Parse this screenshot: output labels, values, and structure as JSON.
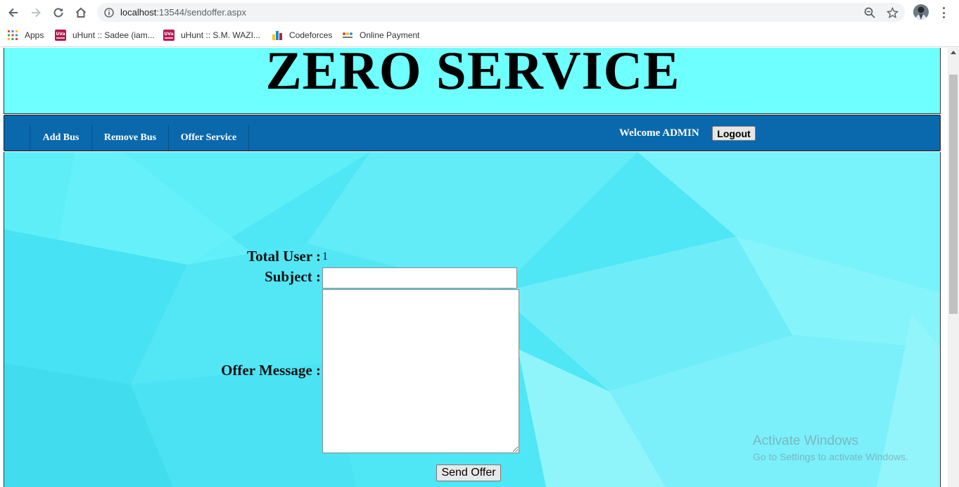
{
  "browser": {
    "url_host": "localhost",
    "url_rest": ":13544/sendoffer.aspx",
    "bookmarks": [
      {
        "label": "Apps",
        "icon": "apps-grid-icon"
      },
      {
        "label": "uHunt :: Sadee (iam...",
        "icon": "uva-icon"
      },
      {
        "label": "uHunt :: S.M. WAZI...",
        "icon": "uva-icon"
      },
      {
        "label": "Codeforces",
        "icon": "codeforces-icon"
      },
      {
        "label": "Online Payment",
        "icon": "payment-icon"
      }
    ]
  },
  "header": {
    "title": "ZERO SERVICE"
  },
  "navbar": {
    "items": [
      "Add Bus",
      "Remove Bus",
      "Offer Service"
    ],
    "welcome": "Welcome ADMIN",
    "logout_label": "Logout"
  },
  "form": {
    "total_user_label": "Total User :",
    "total_user_value": "1",
    "subject_label": "Subject :",
    "subject_value": "",
    "message_label": "Offer Message :",
    "message_value": "",
    "send_label": "Send Offer"
  },
  "watermark": {
    "line1": "Activate Windows",
    "line2": "Go to Settings to activate Windows."
  },
  "colors": {
    "header_bg": "#6effff",
    "navbar_bg": "#0a68ad",
    "content_bg": "#4fe6f5"
  }
}
